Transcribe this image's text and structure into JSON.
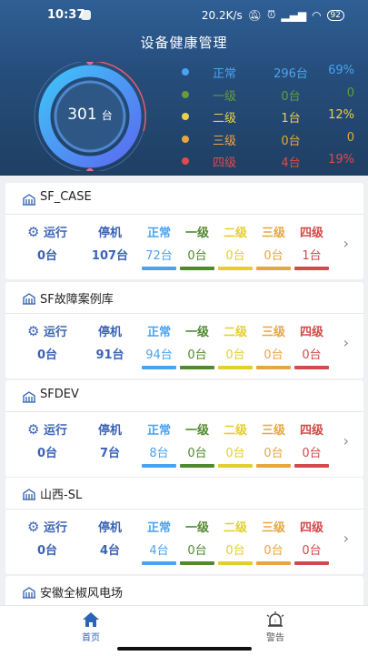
{
  "status_bar": {
    "time": "10:37",
    "speed": "20.2K/s",
    "battery": "92"
  },
  "header": {
    "title": "设备健康管理"
  },
  "summary": {
    "total": "301",
    "unit": "台",
    "levels": [
      {
        "name": "正常",
        "count": "296台",
        "pct": "69%",
        "color": "#4aa3f0"
      },
      {
        "name": "一级",
        "count": "0台",
        "pct": "0",
        "color": "#6a9a3a"
      },
      {
        "name": "二级",
        "count": "1台",
        "pct": "12%",
        "color": "#e8d24a"
      },
      {
        "name": "三级",
        "count": "0台",
        "pct": "0",
        "color": "#e8a640"
      },
      {
        "name": "四级",
        "count": "4台",
        "pct": "19%",
        "color": "#e04a4a"
      }
    ]
  },
  "card_labels": {
    "running": "运行",
    "stopped": "停机",
    "normal": "正常",
    "l1": "一级",
    "l2": "二级",
    "l3": "三级",
    "l4": "四级"
  },
  "sites": [
    {
      "name": "SF_CASE",
      "running": "0台",
      "stopped": "107台",
      "normal": "72台",
      "l1": "0台",
      "l2": "0台",
      "l3": "0台",
      "l4": "1台"
    },
    {
      "name": "SF故障案例库",
      "running": "0台",
      "stopped": "91台",
      "normal": "94台",
      "l1": "0台",
      "l2": "0台",
      "l3": "0台",
      "l4": "0台"
    },
    {
      "name": "SFDEV",
      "running": "0台",
      "stopped": "7台",
      "normal": "8台",
      "l1": "0台",
      "l2": "0台",
      "l3": "0台",
      "l4": "0台"
    },
    {
      "name": "山西-SL",
      "running": "0台",
      "stopped": "4台",
      "normal": "4台",
      "l1": "0台",
      "l2": "0台",
      "l3": "0台",
      "l4": "0台"
    },
    {
      "name": "安徽全椒风电场"
    }
  ],
  "nav": {
    "home": "首页",
    "alarm": "警告"
  },
  "colors": {
    "blue": "#3b63b5",
    "normal": "#4aa3f0",
    "l1": "#4f8a2e",
    "l2": "#e3cf2c",
    "l3": "#e8a640",
    "l4": "#d24a4a"
  }
}
